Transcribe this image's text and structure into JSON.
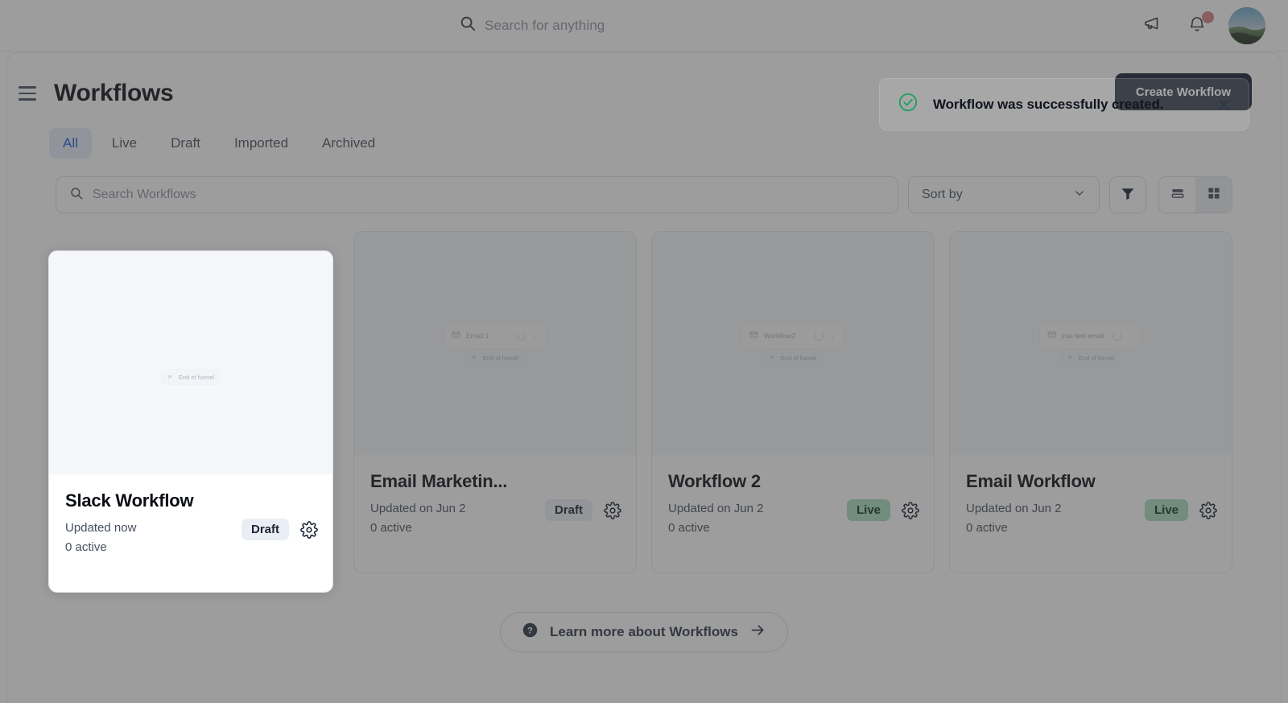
{
  "topbar": {
    "search_placeholder": "Search for anything",
    "search_icon": "search-icon",
    "announcements_icon": "megaphone-icon",
    "notifications_icon": "bell-icon",
    "notification_badge": "",
    "avatar_alt": "User avatar"
  },
  "header": {
    "menu_icon": "hamburger-menu-icon",
    "title": "Workflows",
    "create_label": "Create Workflow"
  },
  "tabs": [
    {
      "label": "All",
      "active": true
    },
    {
      "label": "Live",
      "active": false
    },
    {
      "label": "Draft",
      "active": false
    },
    {
      "label": "Imported",
      "active": false
    },
    {
      "label": "Archived",
      "active": false
    }
  ],
  "toolbar": {
    "search_placeholder": "Search Workflows",
    "search_icon": "search-icon",
    "sort_label": "Sort by",
    "sort_chevron_icon": "chevron-down-icon",
    "filter_icon": "filter-funnel-icon",
    "list_view_icon": "list-view-icon",
    "grid_view_icon": "grid-view-icon",
    "active_view": "grid"
  },
  "toast": {
    "icon": "check-circle-icon",
    "message": "Workflow was successfully created.",
    "close_icon": "close-icon",
    "accent_color": "#22a065"
  },
  "cards": [
    {
      "title": "Slack Workflow",
      "updated": "Updated now",
      "active": "0 active",
      "status": "Draft",
      "status_kind": "draft",
      "gear_icon": "gear-icon",
      "nodes": [],
      "end_node": "End of funnel",
      "highlighted": true
    },
    {
      "title": "Email Marketin...",
      "updated": "Updated on Jun 2",
      "active": "0 active",
      "status": "Draft",
      "status_kind": "draft",
      "gear_icon": "gear-icon",
      "nodes": [
        {
          "label": "Email 1",
          "icon": "envelope-icon",
          "menu_icon": "kebab-menu-icon"
        }
      ],
      "end_node": "End of funnel",
      "highlighted": false
    },
    {
      "title": "Workflow 2",
      "updated": "Updated on Jun 2",
      "active": "0 active",
      "status": "Live",
      "status_kind": "live",
      "gear_icon": "gear-icon",
      "nodes": [
        {
          "label": "Workflow2",
          "icon": "envelope-icon",
          "menu_icon": "kebab-menu-icon"
        }
      ],
      "end_node": "End of funnel",
      "highlighted": false
    },
    {
      "title": "Email Workflow",
      "updated": "Updated on Jun 2",
      "active": "0 active",
      "status": "Live",
      "status_kind": "live",
      "gear_icon": "gear-icon",
      "nodes": [
        {
          "label": "jras test email",
          "icon": "envelope-icon",
          "menu_icon": "kebab-menu-icon"
        }
      ],
      "end_node": "End of funnel",
      "highlighted": false
    }
  ],
  "footer": {
    "learn_more_label": "Learn more about Workflows",
    "help_icon": "question-circle-icon",
    "arrow_icon": "arrow-right-icon"
  },
  "colors": {
    "accent_blue": "#1a56db",
    "live_green": "#a8dcc0",
    "draft_grey": "#eaeef4",
    "dark": "#111b2e",
    "success": "#22a065",
    "notification_red": "#d98080"
  }
}
